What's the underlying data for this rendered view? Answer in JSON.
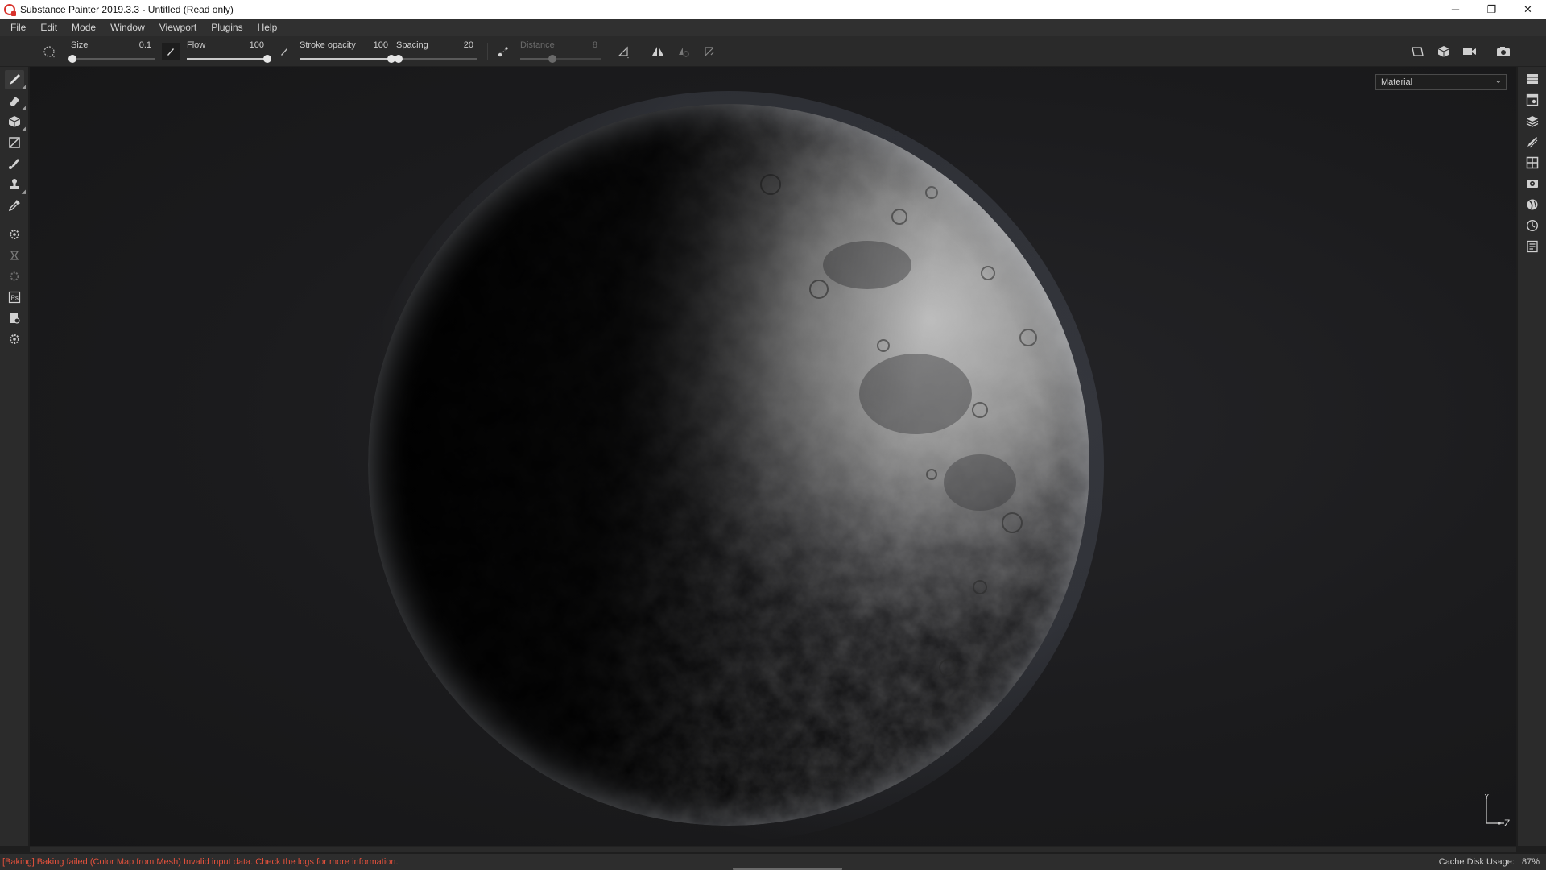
{
  "window": {
    "title": "Substance Painter 2019.3.3 - Untitled (Read only)",
    "minimize_glyph": "─",
    "restore_glyph": "❐",
    "close_glyph": "✕"
  },
  "menu": [
    "File",
    "Edit",
    "Mode",
    "Window",
    "Viewport",
    "Plugins",
    "Help"
  ],
  "tool_options": {
    "size": {
      "label": "Size",
      "value": "0.1",
      "level": 0.02
    },
    "flow": {
      "label": "Flow",
      "value": "100",
      "level": 1.0
    },
    "stroke_opacity": {
      "label": "Stroke opacity",
      "value": "100",
      "level": 1.0
    },
    "spacing": {
      "label": "Spacing",
      "value": "20",
      "level": 0.03
    },
    "distance": {
      "label": "Distance",
      "value": "8",
      "level": 0.4,
      "disabled": true
    }
  },
  "viewport": {
    "channel": "Material",
    "axis_y": "Y",
    "axis_z": "Z"
  },
  "status": {
    "error": "[Baking] Baking failed (Color Map from Mesh) Invalid input data. Check the logs for more information.",
    "cache_label": "Cache Disk Usage:",
    "cache_value": "87%"
  },
  "colors": {
    "error": "#e4513c",
    "accent_red": "#d8322b"
  }
}
